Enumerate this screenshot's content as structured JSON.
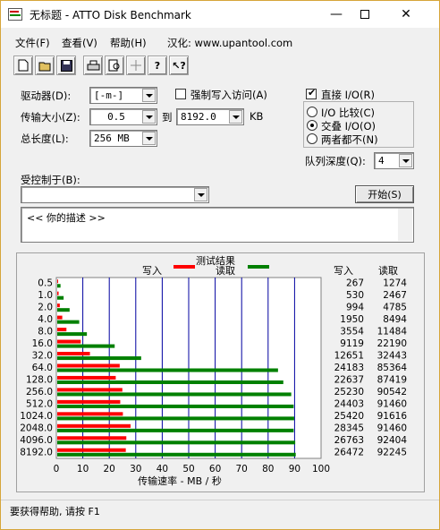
{
  "window": {
    "title": "无标题 - ATTO Disk Benchmark",
    "minimize": "—",
    "maximize": "☐",
    "close": "✕"
  },
  "menu": {
    "file": "文件(F)",
    "view": "查看(V)",
    "help": "帮助(H)",
    "localized": "汉化: www.upantool.com"
  },
  "toolbar": {
    "icons": [
      "new-icon",
      "open-icon",
      "save-icon",
      "print-icon",
      "print-preview-icon",
      "move-icon",
      "help-icon",
      "context-help-icon"
    ]
  },
  "settings": {
    "drive_label": "驱动器(D):",
    "drive_value": "[-m-]",
    "transfer_size_label": "传输大小(Z):",
    "transfer_from": "0.5",
    "to_label": "到",
    "transfer_to": "8192.0",
    "unit": "KB",
    "total_length_label": "总长度(L):",
    "total_length_value": "256 MB",
    "force_write_label": "强制写入访问(A)",
    "direct_io_label": "直接 I/O(R)",
    "io_compare_label": "I/O 比较(C)",
    "overlapped_io_label": "交叠 I/O(O)",
    "neither_label": "两者都不(N)",
    "queue_depth_label": "队列深度(Q):",
    "queue_depth_value": "4",
    "controlled_by_label": "受控制于(B):",
    "controlled_by_value": "",
    "start_button": "开始(S)",
    "description": "<<  你的描述   >>"
  },
  "results": {
    "title": "测试结果",
    "write_legend": "写入",
    "read_legend": "读取",
    "col_write": "写入",
    "col_read": "读取",
    "x_label": "传输速率 - MB / 秒",
    "x_ticks": [
      "0",
      "10",
      "20",
      "30",
      "40",
      "50",
      "60",
      "70",
      "80",
      "90",
      "100"
    ]
  },
  "chart_data": {
    "type": "bar",
    "title": "测试结果",
    "xlabel": "传输速率 - MB / 秒",
    "xlim": [
      0,
      100
    ],
    "categories": [
      "0.5",
      "1.0",
      "2.0",
      "4.0",
      "8.0",
      "16.0",
      "32.0",
      "64.0",
      "128.0",
      "256.0",
      "512.0",
      "1024.0",
      "2048.0",
      "4096.0",
      "8192.0"
    ],
    "series": [
      {
        "name": "写入",
        "color": "#ff0000",
        "values": [
          0.26,
          0.52,
          0.97,
          1.9,
          3.47,
          8.9,
          12.35,
          23.6,
          22.1,
          24.6,
          23.8,
          24.8,
          27.7,
          26.1,
          25.9
        ],
        "kb": [
          267,
          530,
          994,
          1950,
          3554,
          9119,
          12651,
          24183,
          22637,
          25230,
          24403,
          25420,
          28345,
          26763,
          26472
        ]
      },
      {
        "name": "读取",
        "color": "#008000",
        "values": [
          1.24,
          2.41,
          4.67,
          8.3,
          11.2,
          21.7,
          31.7,
          83.4,
          85.4,
          88.4,
          89.3,
          89.5,
          89.3,
          89.9,
          90.1
        ],
        "kb": [
          1274,
          2467,
          4785,
          8494,
          11484,
          22190,
          32443,
          85364,
          87419,
          90542,
          91460,
          91616,
          91460,
          92404,
          92245
        ]
      }
    ],
    "legend": "top"
  },
  "status": {
    "text": "要获得帮助, 请按 F1"
  }
}
